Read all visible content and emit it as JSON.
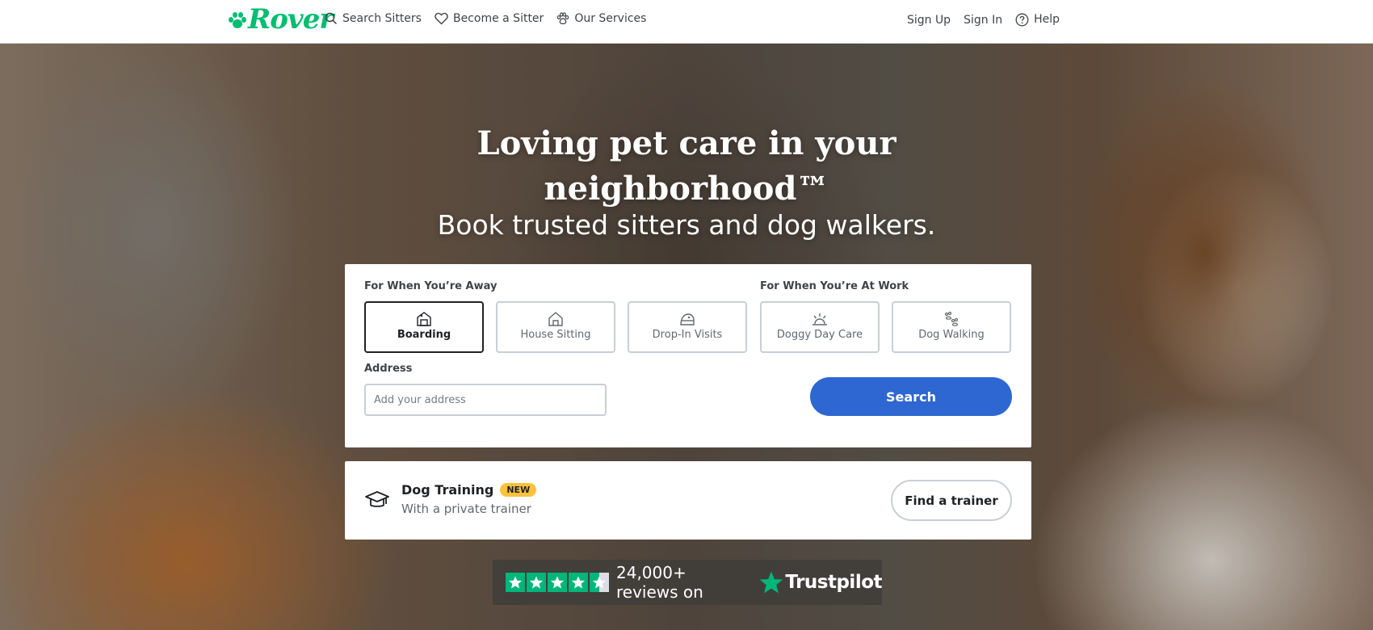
{
  "header": {
    "logo_text": "Rover",
    "nav_left": [
      {
        "label": "Search Sitters",
        "icon": "search-icon"
      },
      {
        "label": "Become a Sitter",
        "icon": "heart-icon"
      },
      {
        "label": "Our Services",
        "icon": "paw-icon"
      }
    ],
    "nav_right": [
      {
        "label": "Sign Up"
      },
      {
        "label": "Sign In"
      },
      {
        "label": "Help",
        "icon": "help-icon"
      }
    ]
  },
  "hero": {
    "title_line1": "Loving pet care in your",
    "title_line2": "neighborhood™",
    "subtitle": "Book trusted sitters and dog walkers."
  },
  "search_card": {
    "group_away": "For When You’re Away",
    "group_work": "For When You’re At Work",
    "services": [
      {
        "label": "Boarding",
        "icon": "boarding-icon",
        "selected": true
      },
      {
        "label": "House Sitting",
        "icon": "house-icon",
        "selected": false
      },
      {
        "label": "Drop-In Visits",
        "icon": "drop-in-icon",
        "selected": false
      },
      {
        "label": "Doggy Day Care",
        "icon": "sun-icon",
        "selected": false
      },
      {
        "label": "Dog Walking",
        "icon": "paw-prints-icon",
        "selected": false
      }
    ],
    "address_label": "Address",
    "address_placeholder": "Add your address",
    "address_value": "",
    "search_label": "Search"
  },
  "training": {
    "title": "Dog Training",
    "badge": "NEW",
    "subtitle": "With a private trainer",
    "button_label": "Find a trainer",
    "icon": "graduation-cap-icon"
  },
  "trustpilot": {
    "rating_stars": 4.5,
    "reviews_text": "24,000+ reviews on",
    "brand": "Trustpilot"
  },
  "colors": {
    "brand_green": "#00bd70",
    "search_blue": "#2e67d1",
    "badge_yellow": "#fcc13d",
    "trustpilot_green": "#00b67a"
  }
}
